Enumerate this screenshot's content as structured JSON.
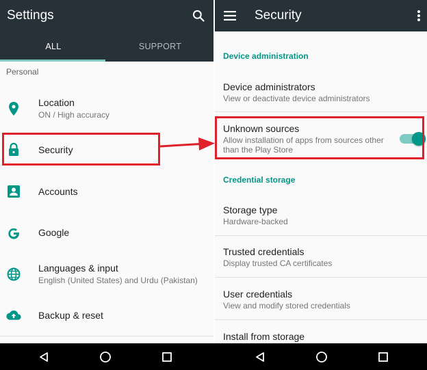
{
  "left": {
    "title": "Settings",
    "tabs": [
      {
        "label": "ALL",
        "active": true
      },
      {
        "label": "SUPPORT",
        "active": false
      }
    ],
    "section": "Personal",
    "items": [
      {
        "title": "Location",
        "subtitle": "ON / High accuracy",
        "icon": "location-pin-icon"
      },
      {
        "title": "Security",
        "subtitle": "",
        "icon": "lock-icon"
      },
      {
        "title": "Accounts",
        "subtitle": "",
        "icon": "account-box-icon"
      },
      {
        "title": "Google",
        "subtitle": "",
        "icon": "google-g-icon"
      },
      {
        "title": "Languages & input",
        "subtitle": "English (United States) and Urdu (Pakistan)",
        "icon": "globe-icon"
      },
      {
        "title": "Backup & reset",
        "subtitle": "",
        "icon": "cloud-upload-icon"
      }
    ]
  },
  "right": {
    "title": "Security",
    "categories": {
      "device_admin": "Device administration",
      "credential_storage": "Credential storage"
    },
    "items": [
      {
        "title": "Device administrators",
        "subtitle": "View or deactivate device administrators"
      },
      {
        "title": "Unknown sources",
        "subtitle": "Allow installation of apps from sources other than the Play Store",
        "toggle": true
      },
      {
        "title": "Storage type",
        "subtitle": "Hardware-backed"
      },
      {
        "title": "Trusted credentials",
        "subtitle": "Display trusted CA certificates"
      },
      {
        "title": "User credentials",
        "subtitle": "View and modify stored credentials"
      },
      {
        "title": "Install from storage",
        "subtitle": ""
      }
    ]
  },
  "colors": {
    "appbar": "#263238",
    "accent": "#009688",
    "highlight": "#e0202b"
  }
}
